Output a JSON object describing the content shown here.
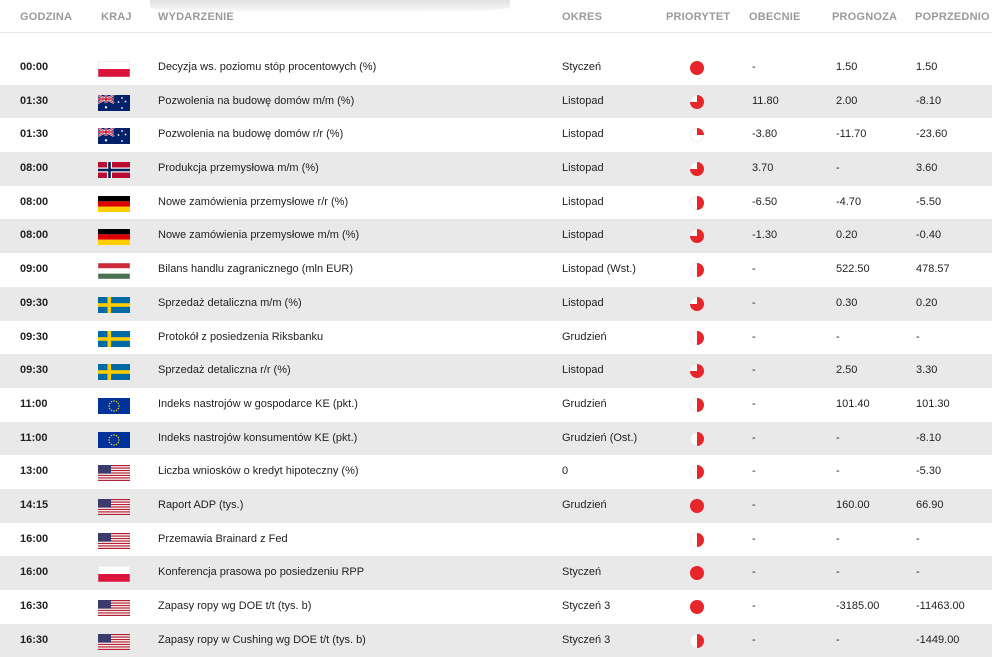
{
  "headers": {
    "time": "GODZINA",
    "country": "KRAJ",
    "event": "WYDARZENIE",
    "period": "OKRES",
    "priority": "PRIORYTET",
    "actual": "OBECNIE",
    "forecast": "PROGNOZA",
    "previous": "POPRZEDNIO"
  },
  "colors": {
    "priority_red": "#e8252b",
    "row_alt": "#e9e9e9",
    "header_text": "#9a9a9a"
  },
  "rows": [
    {
      "time": "00:00",
      "country": "pl",
      "event": "Decyzja ws. poziomu stóp procentowych (%)",
      "period": "Styczeń",
      "priority": "full",
      "actual": "-",
      "forecast": "1.50",
      "previous": "1.50"
    },
    {
      "time": "01:30",
      "country": "au",
      "event": "Pozwolenia na budowę domów m/m (%)",
      "period": "Listopad",
      "priority": "three-quarter",
      "actual": "11.80",
      "forecast": "2.00",
      "previous": "-8.10"
    },
    {
      "time": "01:30",
      "country": "au",
      "event": "Pozwolenia na budowę domów r/r (%)",
      "period": "Listopad",
      "priority": "quarter",
      "actual": "-3.80",
      "forecast": "-11.70",
      "previous": "-23.60"
    },
    {
      "time": "08:00",
      "country": "no",
      "event": "Produkcja przemysłowa m/m (%)",
      "period": "Listopad",
      "priority": "three-quarter",
      "actual": "3.70",
      "forecast": "-",
      "previous": "3.60"
    },
    {
      "time": "08:00",
      "country": "de",
      "event": "Nowe zamówienia przemysłowe r/r (%)",
      "period": "Listopad",
      "priority": "half",
      "actual": "-6.50",
      "forecast": "-4.70",
      "previous": "-5.50"
    },
    {
      "time": "08:00",
      "country": "de",
      "event": "Nowe zamówienia przemysłowe m/m (%)",
      "period": "Listopad",
      "priority": "three-quarter",
      "actual": "-1.30",
      "forecast": "0.20",
      "previous": "-0.40"
    },
    {
      "time": "09:00",
      "country": "hu",
      "event": "Bilans handlu zagranicznego (mln EUR)",
      "period": "Listopad (Wst.)",
      "priority": "half",
      "actual": "-",
      "forecast": "522.50",
      "previous": "478.57"
    },
    {
      "time": "09:30",
      "country": "se",
      "event": "Sprzedaż detaliczna m/m (%)",
      "period": "Listopad",
      "priority": "three-quarter",
      "actual": "-",
      "forecast": "0.30",
      "previous": "0.20"
    },
    {
      "time": "09:30",
      "country": "se",
      "event": "Protokół z posiedzenia Riksbanku",
      "period": "Grudzień",
      "priority": "half",
      "actual": "-",
      "forecast": "-",
      "previous": "-"
    },
    {
      "time": "09:30",
      "country": "se",
      "event": "Sprzedaż detaliczna r/r (%)",
      "period": "Listopad",
      "priority": "three-quarter",
      "actual": "-",
      "forecast": "2.50",
      "previous": "3.30"
    },
    {
      "time": "11:00",
      "country": "eu",
      "event": "Indeks nastrojów w gospodarce KE (pkt.)",
      "period": "Grudzień",
      "priority": "half",
      "actual": "-",
      "forecast": "101.40",
      "previous": "101.30"
    },
    {
      "time": "11:00",
      "country": "eu",
      "event": "Indeks nastrojów konsumentów KE (pkt.)",
      "period": "Grudzień (Ost.)",
      "priority": "half",
      "actual": "-",
      "forecast": "-",
      "previous": "-8.10"
    },
    {
      "time": "13:00",
      "country": "us",
      "event": "Liczba wniosków o kredyt hipoteczny (%)",
      "period": "0",
      "priority": "half",
      "actual": "-",
      "forecast": "-",
      "previous": "-5.30"
    },
    {
      "time": "14:15",
      "country": "us",
      "event": "Raport ADP (tys.)",
      "period": "Grudzień",
      "priority": "full",
      "actual": "-",
      "forecast": "160.00",
      "previous": "66.90"
    },
    {
      "time": "16:00",
      "country": "us",
      "event": "Przemawia Brainard z Fed",
      "period": "",
      "priority": "half",
      "actual": "-",
      "forecast": "-",
      "previous": "-"
    },
    {
      "time": "16:00",
      "country": "pl",
      "event": "Konferencja prasowa po posiedzeniu RPP",
      "period": "Styczeń",
      "priority": "full",
      "actual": "-",
      "forecast": "-",
      "previous": "-"
    },
    {
      "time": "16:30",
      "country": "us",
      "event": "Zapasy ropy wg DOE t/t (tys. b)",
      "period": "Styczeń 3",
      "priority": "full",
      "actual": "-",
      "forecast": "-3185.00",
      "previous": "-11463.00"
    },
    {
      "time": "16:30",
      "country": "us",
      "event": "Zapasy ropy w Cushing wg DOE t/t (tys. b)",
      "period": "Styczeń 3",
      "priority": "half",
      "actual": "-",
      "forecast": "-",
      "previous": "-1449.00"
    }
  ]
}
